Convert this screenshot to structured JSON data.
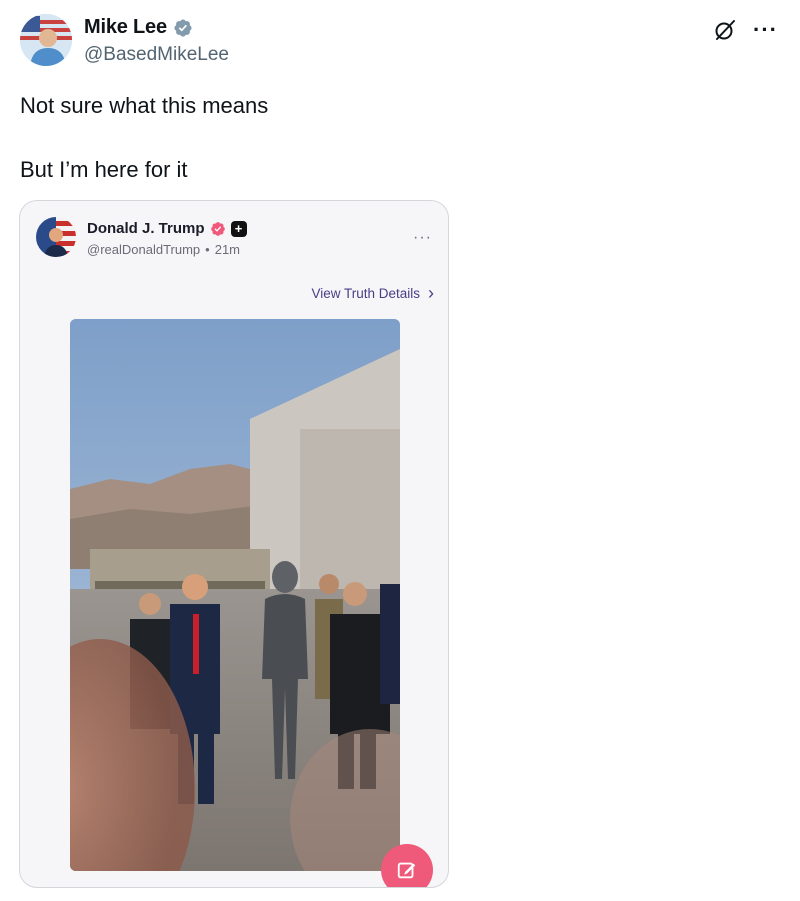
{
  "tweet": {
    "author_name": "Mike Lee",
    "author_handle": "@BasedMikeLee",
    "text_lines": [
      "Not sure what this means",
      "But I’m here for it"
    ],
    "icons": {
      "verified": "verified-badge-icon",
      "grok": "grok-icon",
      "more": "more-options-icon"
    },
    "more_label": "···"
  },
  "embedded_post": {
    "author_name": "Donald J. Trump",
    "author_handle": "@realDonaldTrump",
    "separator": "•",
    "time": "21m",
    "plus_label": "+",
    "more_label": "···",
    "view_details_label": "View Truth Details",
    "chevron": "›",
    "icons": {
      "badge": "verified-badge-icon",
      "compose": "compose-icon"
    },
    "colors": {
      "accent": "#4a3d86",
      "compose": "#f05a7a",
      "badge": "#f05a7a"
    }
  },
  "colors": {
    "handle": "#536471",
    "verified": "#829aab"
  }
}
